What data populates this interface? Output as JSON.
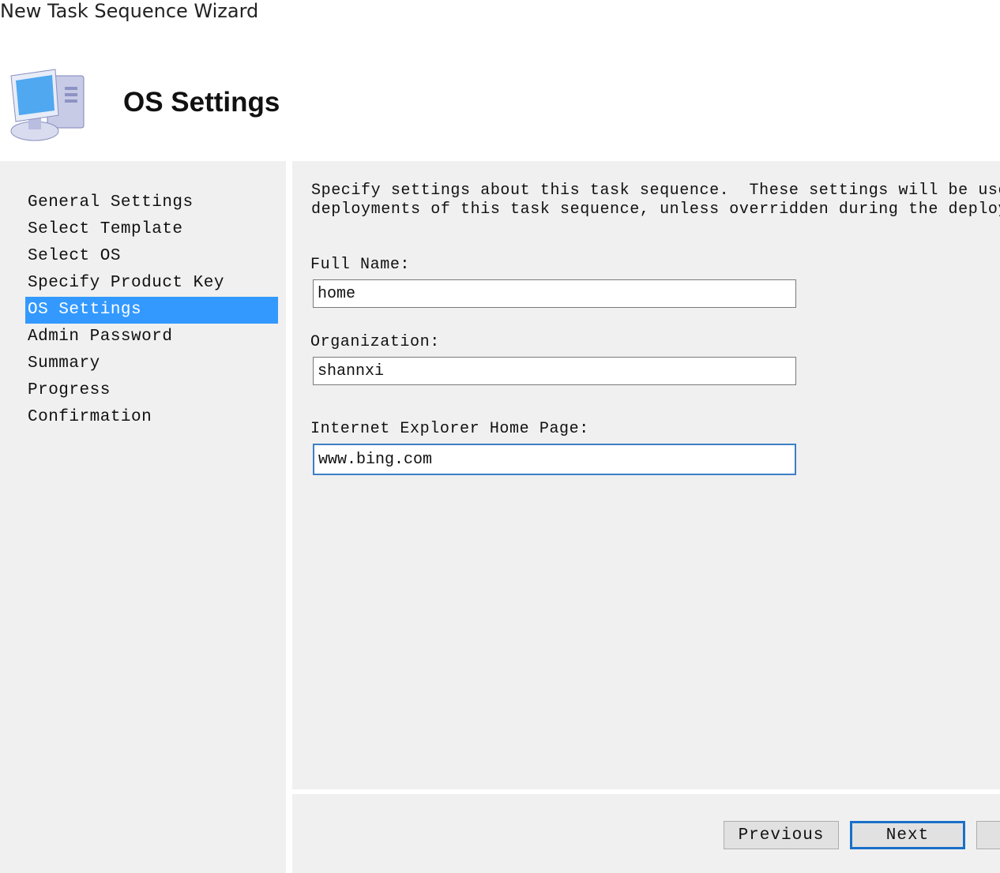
{
  "window": {
    "title": "New Task Sequence Wizard"
  },
  "header": {
    "title": "OS Settings",
    "icon": "computer-icon"
  },
  "sidebar": {
    "items": [
      {
        "label": "General Settings",
        "active": false
      },
      {
        "label": "Select Template",
        "active": false
      },
      {
        "label": "Select OS",
        "active": false
      },
      {
        "label": "Specify Product Key",
        "active": false
      },
      {
        "label": "OS Settings",
        "active": true
      },
      {
        "label": "Admin Password",
        "active": false
      },
      {
        "label": "Summary",
        "active": false
      },
      {
        "label": "Progress",
        "active": false
      },
      {
        "label": "Confirmation",
        "active": false
      }
    ]
  },
  "main": {
    "description_line1": "Specify settings about this task sequence.  These settings will be used f",
    "description_line2": "deployments of this task sequence, unless overridden during the deploymen",
    "full_name": {
      "label": "Full Name:",
      "value": "home"
    },
    "organization": {
      "label": "Organization:",
      "value": "shannxi"
    },
    "home_page": {
      "label": "Internet Explorer Home Page:",
      "value": "www.bing.com"
    }
  },
  "footer": {
    "previous_label": "Previous",
    "next_label": "Next"
  },
  "colors": {
    "accent": "#3399ff",
    "focus_border": "#3c7fc4",
    "panel_bg": "#f0f0f0"
  }
}
